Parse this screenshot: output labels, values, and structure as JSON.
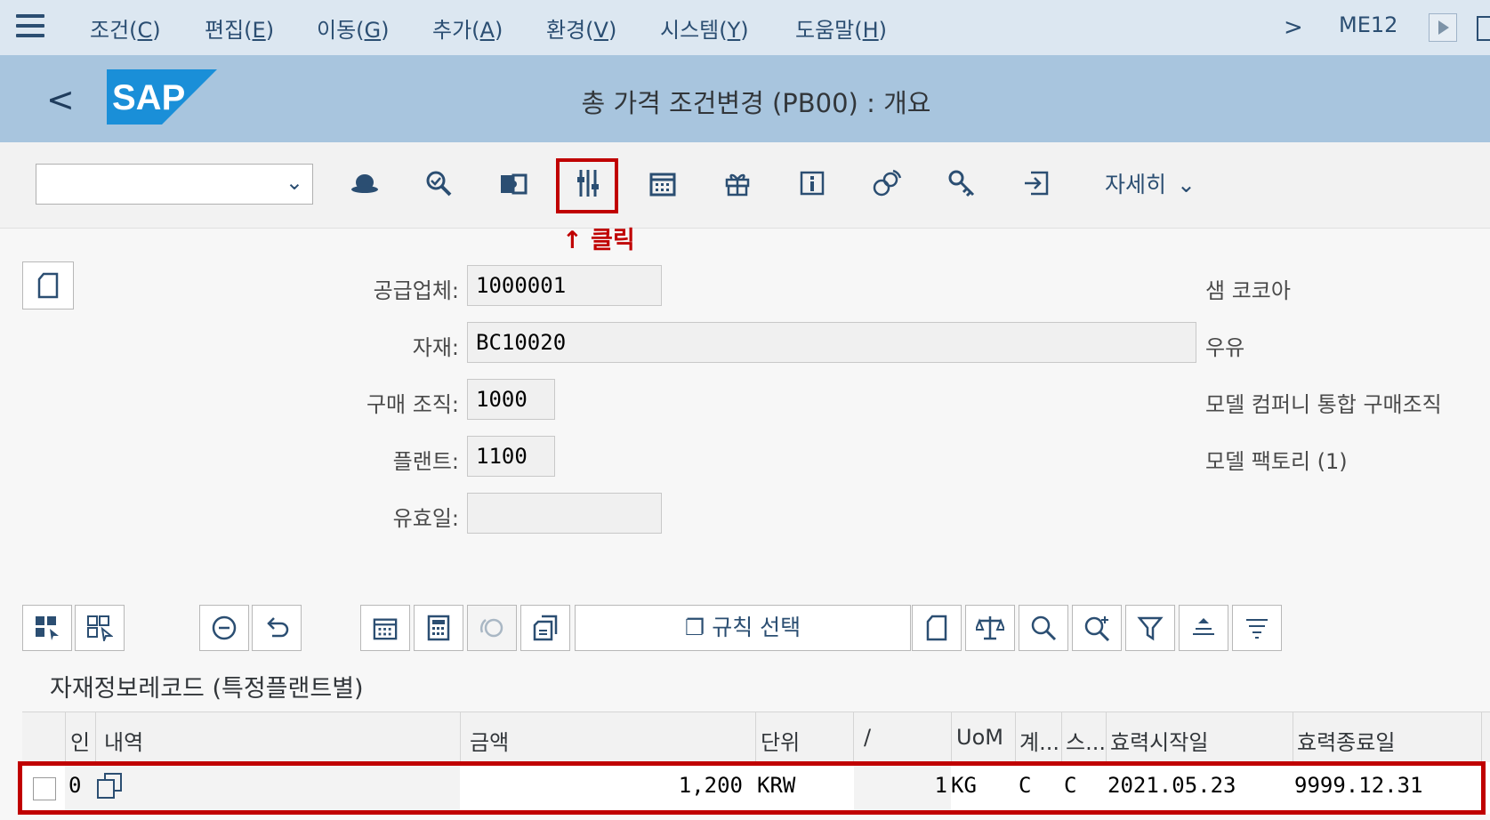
{
  "menubar": {
    "items": [
      {
        "label": "조건(",
        "key": "C",
        "suffix": ")"
      },
      {
        "label": "편집(",
        "key": "E",
        "suffix": ")"
      },
      {
        "label": "이동(",
        "key": "G",
        "suffix": ")"
      },
      {
        "label": "추가(",
        "key": "A",
        "suffix": ")"
      },
      {
        "label": "환경(",
        "key": "V",
        "suffix": ")"
      },
      {
        "label": "시스템(",
        "key": "Y",
        "suffix": ")"
      },
      {
        "label": "도움말(",
        "key": "H",
        "suffix": ")"
      }
    ],
    "tcode": "ME12"
  },
  "header": {
    "title": "총 가격 조건변경 (PB00) : 개요",
    "logo_text": "SAP"
  },
  "toolbar": {
    "more_label": "자세히",
    "annotation": "↑ 클릭",
    "icons": [
      "hat-icon",
      "check-search-icon",
      "puzzle-icon",
      "columns-icon",
      "calendar-icon",
      "gift-icon",
      "info-icon",
      "coins-icon",
      "key-icon",
      "export-icon"
    ]
  },
  "form": {
    "vendor_label": "공급업체:",
    "vendor_value": "1000001",
    "vendor_desc": "샘 코코아",
    "material_label": "자재:",
    "material_value": "BC10020",
    "material_desc": "우유",
    "purch_org_label": "구매 조직:",
    "purch_org_value": "1000",
    "purch_org_desc": "모델 컴퍼니 통합 구매조직",
    "plant_label": "플랜트:",
    "plant_value": "1100",
    "plant_desc": "모델 팩토리 (1)",
    "valid_label": "유효일:",
    "valid_value": ""
  },
  "grid_toolbar": {
    "rule_select_label": "규칙 선택"
  },
  "section": {
    "title": "자재정보레코드 (특정플랜트별)"
  },
  "table": {
    "columns": [
      "인",
      "내역",
      "금액",
      "단위",
      "/",
      "UoM",
      "계...",
      "스...",
      "효력시작일",
      "효력종료일"
    ],
    "rows": [
      {
        "ind": "0",
        "desc": "",
        "amount": "1,200",
        "unit": "KRW",
        "per": "1",
        "uom": "KG",
        "calc": "C",
        "status": "C",
        "valid_from": "2021.05.23",
        "valid_to": "9999.12.31"
      }
    ]
  },
  "colors": {
    "menubar": "#dce7f1",
    "titlebar": "#a8c5de",
    "highlight": "#c00000",
    "icon": "#2b4e72"
  }
}
